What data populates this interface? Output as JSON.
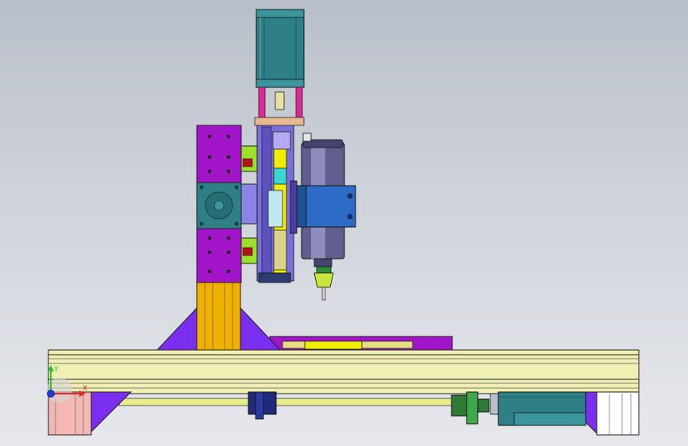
{
  "viewport": {
    "background_top": "#b9bfc9",
    "background_bottom": "#e6e8ec"
  },
  "triad": {
    "x_label": "X",
    "y_label": "Y",
    "x_color": "#e8262b",
    "y_color": "#2bbf2b",
    "origin_color": "#1b3de0"
  },
  "colors": {
    "purple": "#a214c7",
    "violet": "#7a2ef0",
    "stepper_teal": "#2e7f86",
    "spindle_blue": "#2c6cc6",
    "rail_yellow": "#f1f0b3",
    "column_orange": "#f0b000",
    "lime": "#9be02a",
    "magenta": "#e0289a"
  }
}
